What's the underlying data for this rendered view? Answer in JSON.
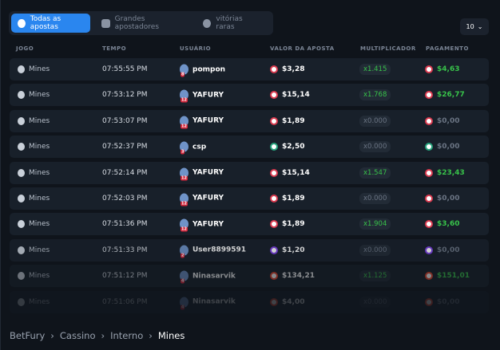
{
  "tabs": [
    {
      "label": "Todas as apostas",
      "icon": "coins-icon",
      "active": true
    },
    {
      "label": "Grandes apostadores",
      "icon": "chart-icon"
    },
    {
      "label": "vitórias raras",
      "icon": "medal-icon"
    }
  ],
  "page_size": "10",
  "columns": [
    "JOGO",
    "TEMPO",
    "USUÁRIO",
    "VALOR DA APOSTA",
    "MULTIPLICADOR",
    "PAGAMENTO"
  ],
  "rows": [
    {
      "game": "Mines",
      "time": "07:55:55 PM",
      "user": "pompon",
      "level": "8",
      "bet": "$3,28",
      "mult": "x1.415",
      "pay": "$4,63",
      "coin": "#d93a4f",
      "win": true
    },
    {
      "game": "Mines",
      "time": "07:53:12 PM",
      "user": "YAFURY",
      "level": "12",
      "bet": "$15,14",
      "mult": "x1.768",
      "pay": "$26,77",
      "coin": "#d93a4f",
      "win": true
    },
    {
      "game": "Mines",
      "time": "07:53:07 PM",
      "user": "YAFURY",
      "level": "12",
      "bet": "$1,89",
      "mult": "x0.000",
      "pay": "$0,00",
      "coin": "#d93a4f",
      "win": false
    },
    {
      "game": "Mines",
      "time": "07:52:37 PM",
      "user": "csp",
      "level": "3",
      "bet": "$2,50",
      "mult": "x0.000",
      "pay": "$0,00",
      "coin": "#26a17b",
      "win": false
    },
    {
      "game": "Mines",
      "time": "07:52:14 PM",
      "user": "YAFURY",
      "level": "12",
      "bet": "$15,14",
      "mult": "x1.547",
      "pay": "$23,43",
      "coin": "#d93a4f",
      "win": true
    },
    {
      "game": "Mines",
      "time": "07:52:03 PM",
      "user": "YAFURY",
      "level": "12",
      "bet": "$1,89",
      "mult": "x0.000",
      "pay": "$0,00",
      "coin": "#d93a4f",
      "win": false
    },
    {
      "game": "Mines",
      "time": "07:51:36 PM",
      "user": "YAFURY",
      "level": "12",
      "bet": "$1,89",
      "mult": "x1.904",
      "pay": "$3,60",
      "coin": "#d93a4f",
      "win": true
    },
    {
      "game": "Mines",
      "time": "07:51:33 PM",
      "user": "User8899591",
      "level": "2",
      "bet": "$1,20",
      "mult": "x0.000",
      "pay": "$0,00",
      "coin": "#7b3fe4",
      "win": false
    },
    {
      "game": "Mines",
      "time": "07:51:12 PM",
      "user": "Ninasarvik",
      "level": "4",
      "bet": "$134,21",
      "mult": "x1.125",
      "pay": "$151,01",
      "coin": "#e8442c",
      "win": true
    },
    {
      "game": "Mines",
      "time": "07:51:06 PM",
      "user": "Ninasarvik",
      "level": "4",
      "bet": "$4,00",
      "mult": "x0.000",
      "pay": "$0,00",
      "coin": "#e8442c",
      "win": false
    }
  ],
  "breadcrumb": [
    "BetFury",
    "Cassino",
    "Interno",
    "Mines"
  ]
}
